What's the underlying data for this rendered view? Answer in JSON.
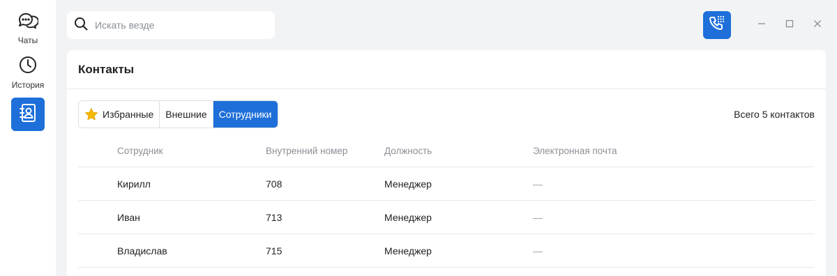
{
  "nav": {
    "items": [
      {
        "label": "Чаты",
        "icon": "chat-bubbles-icon"
      },
      {
        "label": "История",
        "icon": "clock-icon"
      },
      {
        "label": "",
        "icon": "contacts-book-icon",
        "active": true
      }
    ]
  },
  "search": {
    "placeholder": "Искать везде"
  },
  "window": {
    "call_icon": "phone-dialpad-icon",
    "minimize": "minimize-icon",
    "maximize": "maximize-icon",
    "close": "close-icon"
  },
  "page": {
    "title": "Контакты",
    "tabs": [
      {
        "label": "Избранные",
        "icon": "star-icon"
      },
      {
        "label": "Внешние"
      },
      {
        "label": "Сотрудники",
        "active": true
      }
    ],
    "total": "Всего 5 контактов"
  },
  "table": {
    "headers": [
      "Сотрудник",
      "Внутренний номер",
      "Должность",
      "Электронная почта"
    ],
    "rows": [
      [
        "Кирилл",
        "708",
        "Менеджер",
        "—"
      ],
      [
        "Иван",
        "713",
        "Менеджер",
        "—"
      ],
      [
        "Владислав",
        "715",
        "Менеджер",
        "—"
      ]
    ]
  },
  "colors": {
    "accent": "#1e6fd9",
    "star": "#f6b800",
    "background": "#f2f3f4"
  }
}
